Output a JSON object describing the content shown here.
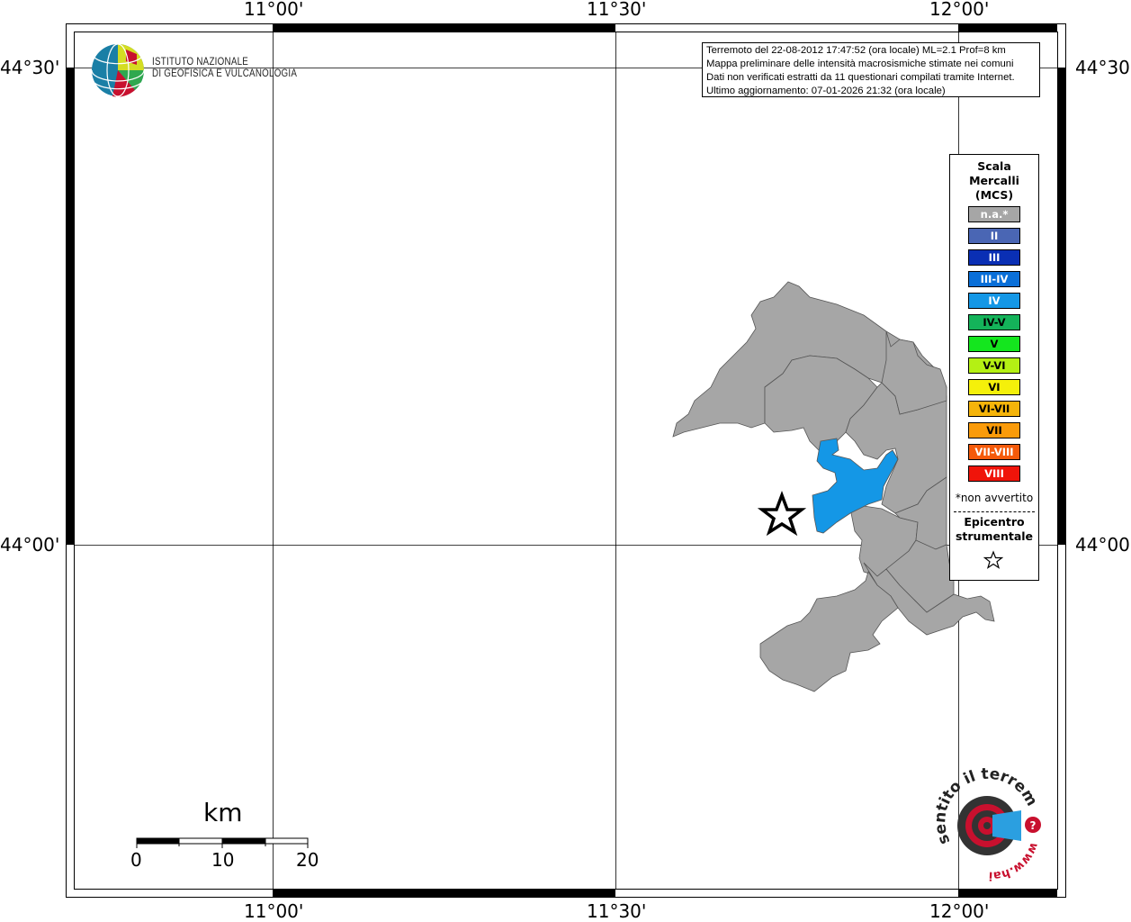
{
  "map": {
    "lon_labels": [
      "11°00'",
      "11°30'",
      "12°00'"
    ],
    "lat_labels": [
      "44°30'",
      "44°00'"
    ]
  },
  "institute": {
    "line1": "ISTITUTO NAZIONALE",
    "line2": "DI GEOFISICA E VULCANOLOGIA"
  },
  "info": {
    "line1": "Terremoto del 22-08-2012 17:47:52 (ora locale) ML=2.1 Prof=8 km",
    "line2": "Mappa preliminare delle intensità macrosismiche stimate nei comuni",
    "line3": "Dati non verificati estratti da 11 questionari compilati tramite Internet.",
    "line4": "Ultimo aggiornamento: 07-01-2026 21:32 (ora locale)"
  },
  "legend": {
    "title1": "Scala",
    "title2": "Mercalli",
    "title3": "(MCS)",
    "items": [
      {
        "label": "n.a.*",
        "color": "#a6a6a6"
      },
      {
        "label": "II",
        "color": "#4a66b4"
      },
      {
        "label": "III",
        "color": "#0a2fb4"
      },
      {
        "label": "III-IV",
        "color": "#0a6fd8"
      },
      {
        "label": "IV",
        "color": "#1497e6"
      },
      {
        "label": "IV-V",
        "color": "#14b35a"
      },
      {
        "label": "V",
        "color": "#14e61e"
      },
      {
        "label": "V-VI",
        "color": "#b4f014"
      },
      {
        "label": "VI",
        "color": "#f5f00a"
      },
      {
        "label": "VI-VII",
        "color": "#f5b40a"
      },
      {
        "label": "VII",
        "color": "#fa9b0a"
      },
      {
        "label": "VII-VIII",
        "color": "#f55a0a"
      },
      {
        "label": "VIII",
        "color": "#f0140a"
      }
    ],
    "note": "*non avvertito",
    "epi1": "Epicentro",
    "epi2": "strumentale"
  },
  "scalebar": {
    "unit": "km",
    "ticks": [
      "0",
      "10",
      "20"
    ]
  },
  "watermark": {
    "text_top": "sentito il terremoto.it",
    "text_bottom": "www.hai"
  }
}
